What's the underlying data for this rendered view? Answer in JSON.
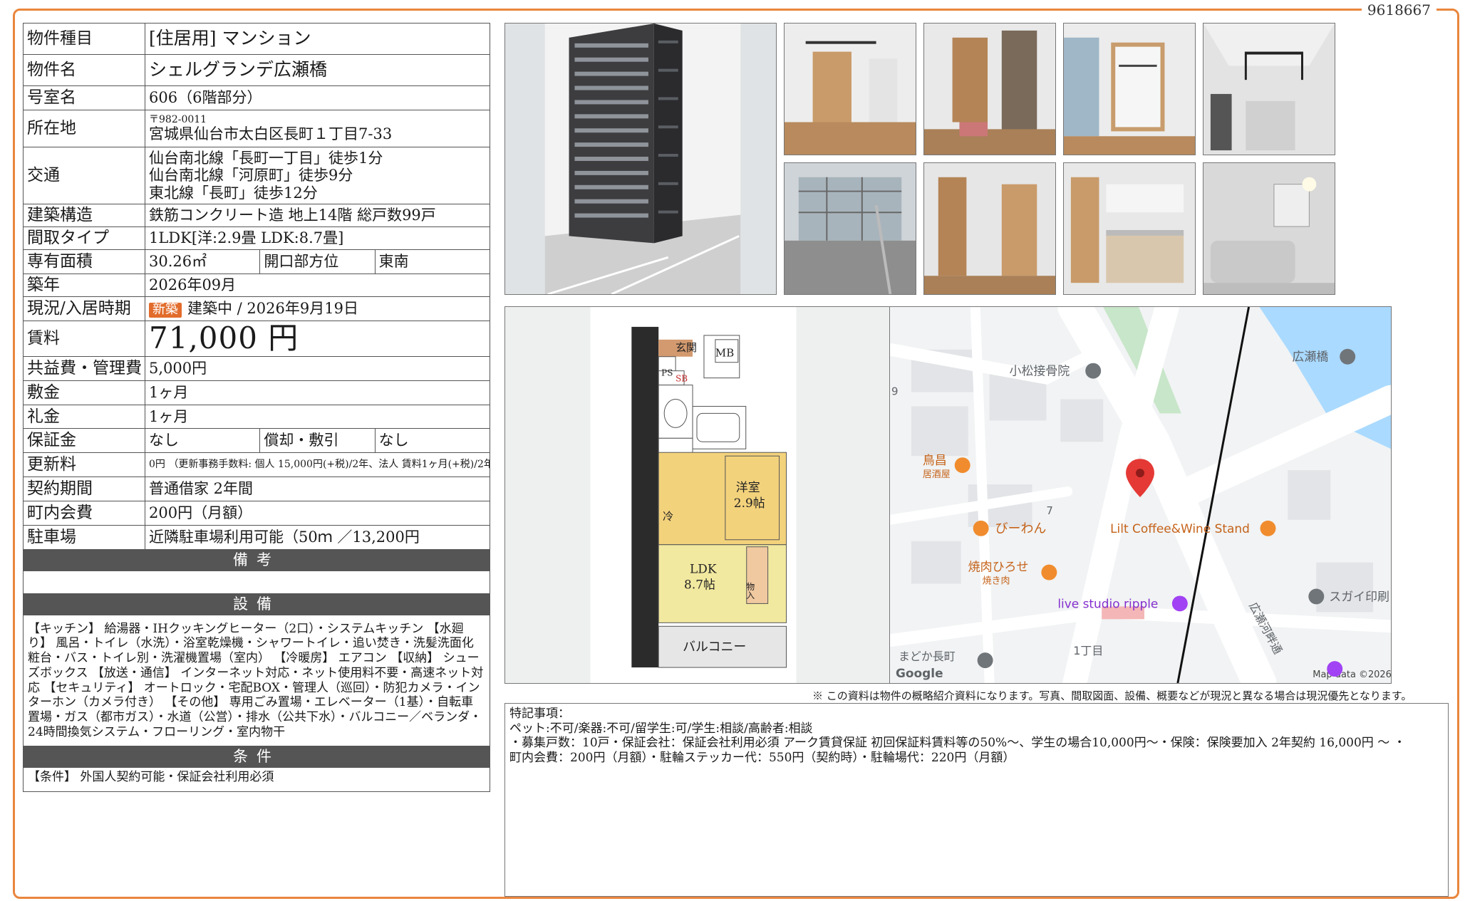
{
  "doc_id": "9618667",
  "property": {
    "type_label": "物件種目",
    "type_value": "[住居用] マンション",
    "name_label": "物件名",
    "name_value": "シェルグランデ広瀬橋",
    "room_label": "号室名",
    "room_value": "606（6階部分）",
    "address_label": "所在地",
    "postal": "〒982-0011",
    "address": "宮城県仙台市太白区長町１丁目7-33",
    "access_label": "交通",
    "access": [
      "仙台南北線「長町一丁目」徒歩1分",
      "仙台南北線「河原町」徒歩9分",
      "東北線「長町」徒歩12分"
    ],
    "structure_label": "建築構造",
    "structure_value": "鉄筋コンクリート造 地上14階 総戸数99戸",
    "layout_label": "間取タイプ",
    "layout_value": "1LDK[洋:2.9畳 LDK:8.7畳]",
    "area_label": "専有面積",
    "area_value": "30.26㎡",
    "direction_label": "開口部方位",
    "direction_value": "東南",
    "built_label": "築年",
    "built_value": "2026年09月",
    "status_label": "現況/入居時期",
    "status_badge": "新築",
    "status_value": "建築中 / 2026年9月19日",
    "rent_label": "賃料",
    "rent_value": "71,000 円",
    "fee_label": "共益費・管理費",
    "fee_value": "5,000円",
    "deposit_label": "敷金",
    "deposit_value": "1ヶ月",
    "keymoney_label": "礼金",
    "keymoney_value": "1ヶ月",
    "guarantee_label": "保証金",
    "guarantee_value": "なし",
    "amort_label": "償却・敷引",
    "amort_value": "なし",
    "renewal_label": "更新料",
    "renewal_value": "0円 （更新事務手数料: 個人 15,000円(+税)/2年、法人 賃料1ヶ月(+税)/2年)",
    "contract_label": "契約期間",
    "contract_value": "普通借家 2年間",
    "community_label": "町内会費",
    "community_value": "200円（月額）",
    "parking_label": "駐車場",
    "parking_value": "近隣駐車場利用可能（50ｍ ／13,200円"
  },
  "remarks_header": "備考",
  "remarks_text": "",
  "equipment_header": "設備",
  "equipment_text": "【キッチン】 給湯器・IHクッキングヒーター（2口）・システムキッチン 【水廻り】 風呂・トイレ（水洗）・浴室乾燥機・シャワートイレ・追い焚き・洗髪洗面化粧台・バス・トイレ別・洗濯機置場（室内） 【冷暖房】 エアコン 【収納】 シューズボックス 【放送・通信】 インターネット対応・ネット使用料不要・高速ネット対応 【セキュリティ】 オートロック・宅配BOX・管理人（巡回）・防犯カメラ・インターホン（カメラ付き） 【その他】 専用ごみ置場・エレベーター（1基）・自転車置場・ガス（都市ガス）・水道（公営）・排水（公共下水）・バルコニー／ベランダ・24時間換気システム・フローリング・室内物干",
  "conditions_header": "条件",
  "conditions_text": "【条件】 外国人契約可能・保証会社利用必須",
  "floorplan": {
    "rooms": [
      "玄関",
      "MB",
      "PS",
      "SB",
      "冷",
      "洋室",
      "2.9帖",
      "LDK",
      "8.7帖",
      "物入",
      "バルコニー"
    ]
  },
  "map": {
    "labels": [
      "小松接骨院",
      "広瀬橋",
      "鳥昌",
      "居酒屋",
      "びーわん",
      "Lilt Coffee&Wine Stand",
      "焼肉ひろせ",
      "焼き肉",
      "live studio ripple",
      "スガイ印刷",
      "広瀬河畔通",
      "1丁目",
      "まどか長町",
      "7",
      "9",
      "Google",
      "Map data ©2026"
    ],
    "colors": {
      "water": "#aadaff",
      "road": "#ffffff",
      "park": "#c8e6c9",
      "pin": "#e53935",
      "poi_orange": "#f08c2e",
      "poi_gray": "#70757a",
      "poi_purple": "#a142f4"
    }
  },
  "disclaimer": "※ この資料は物件の概略紹介資料になります。写真、間取図面、設備、概要などが現況と異なる場合は現況優先となります。",
  "special_title": "特記事項：",
  "special_lines": [
    "ペット:不可/楽器:不可/留学生:可/学生:相談/高齢者:相談",
    "・募集戸数：10戸・保証会社：保証会社利用必須 アーク賃貸保証 初回保証料賃料等の50%～、学生の場合10,000円～・保険：保険要加入 2年契約 16,000円 ～ ・",
    "町内会費：200円（月額）・駐輪ステッカー代：550円（契約時）・駐輪場代：220円（月額）"
  ],
  "colors": {
    "frame": "#e9863d",
    "header_bg": "#555555",
    "badge": "#e26c2b"
  }
}
